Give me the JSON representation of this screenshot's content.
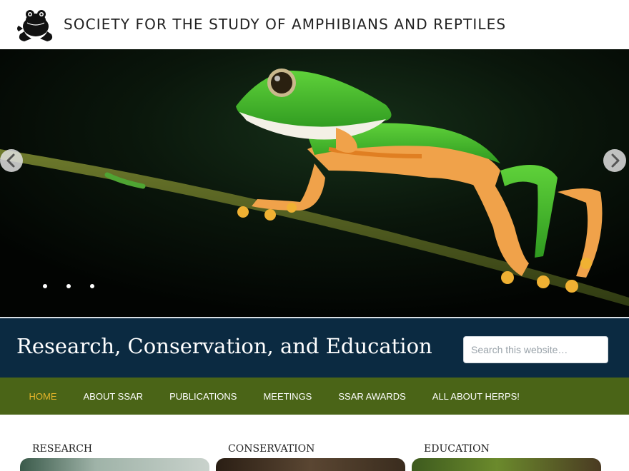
{
  "header": {
    "site_title": "SOCIETY FOR THE STUDY OF AMPHIBIANS AND REPTILES",
    "logo_icon": "frog-logo-icon"
  },
  "hero": {
    "prev_icon": "chevron-left-icon",
    "next_icon": "chevron-right-icon",
    "slide_count": 3
  },
  "banner": {
    "tagline": "Research, Conservation, and Education",
    "search_placeholder": "Search this website…"
  },
  "nav": {
    "items": [
      {
        "label": "HOME",
        "active": true
      },
      {
        "label": "ABOUT SSAR",
        "active": false
      },
      {
        "label": "PUBLICATIONS",
        "active": false
      },
      {
        "label": "MEETINGS",
        "active": false
      },
      {
        "label": "SSAR AWARDS",
        "active": false
      },
      {
        "label": "ALL ABOUT HERPS!",
        "active": false
      }
    ]
  },
  "features": [
    {
      "title": "RESEARCH"
    },
    {
      "title": "CONSERVATION"
    },
    {
      "title": "EDUCATION"
    }
  ],
  "colors": {
    "banner_bg": "#0b2a41",
    "nav_bg": "#4a6417",
    "nav_active": "#e6b52a"
  }
}
